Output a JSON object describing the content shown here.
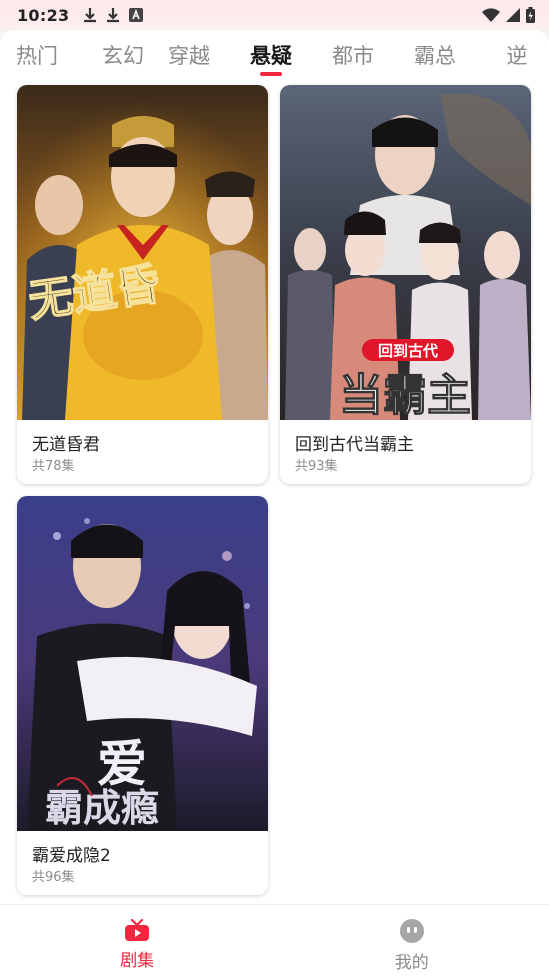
{
  "status_bar": {
    "time": "10:23",
    "icons_left": [
      "download-icon",
      "download-icon",
      "font-a-icon"
    ],
    "icons_right": [
      "wifi-icon",
      "signal-icon",
      "battery-icon"
    ]
  },
  "tabs": [
    {
      "label": "热门",
      "active": false
    },
    {
      "label": "玄幻",
      "active": false
    },
    {
      "label": "穿越",
      "active": false
    },
    {
      "label": "悬疑",
      "active": true
    },
    {
      "label": "都市",
      "active": false
    },
    {
      "label": "霸总",
      "active": false
    },
    {
      "label": "逆",
      "active": false
    }
  ],
  "cards": [
    {
      "title": "无道昏君",
      "episodes": "共78集",
      "poster_text": "无道昏"
    },
    {
      "title": "回到古代当霸主",
      "episodes": "共93集",
      "poster_badge": "回到古代",
      "poster_text": "当霸主"
    },
    {
      "title": "霸爱成隐2",
      "episodes": "共96集",
      "poster_text_top": "爱",
      "poster_text_bottom": "霸成瘾"
    }
  ],
  "bottom_nav": [
    {
      "label": "剧集",
      "icon": "tv-icon",
      "active": true
    },
    {
      "label": "我的",
      "icon": "profile-face-icon",
      "active": false
    }
  ],
  "colors": {
    "accent": "#f0283f",
    "inactive": "#8a8a8a"
  }
}
